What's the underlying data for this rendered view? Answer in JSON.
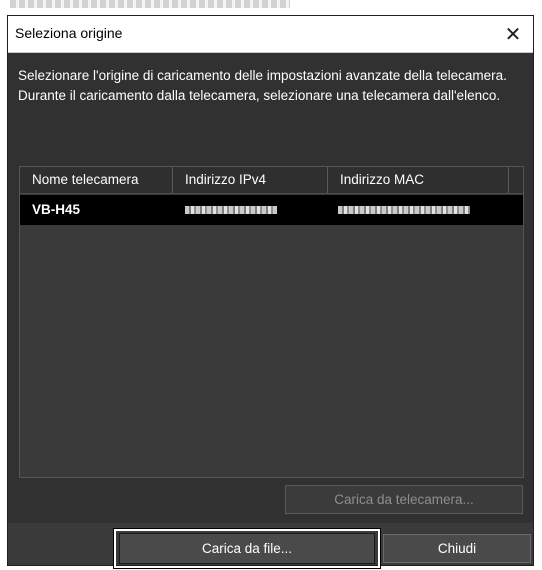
{
  "window": {
    "title": "Seleziona origine",
    "close_glyph": "✕"
  },
  "description": {
    "line1": "Selezionare l'origine di caricamento delle impostazioni avanzate della telecamera.",
    "line2": "Durante il caricamento dalla telecamera, selezionare una telecamera dall'elenco."
  },
  "camera_list": {
    "columns": [
      "Nome telecamera",
      "Indirizzo IPv4",
      "Indirizzo MAC"
    ],
    "rows": [
      {
        "name": "VB-H45",
        "ipv4": "(blurred)",
        "mac": "(blurred)"
      }
    ]
  },
  "buttons": {
    "load_from_camera": "Carica da telecamera...",
    "load_from_file": "Carica da file...",
    "close": "Chiudi"
  },
  "colors": {
    "dialog_bg": "#313131",
    "list_bg": "#3a3a3a",
    "selected_row": "#000000",
    "text": "#ffffff",
    "disabled_text": "#8e8e8e"
  },
  "icons": {
    "close": "close-icon"
  }
}
